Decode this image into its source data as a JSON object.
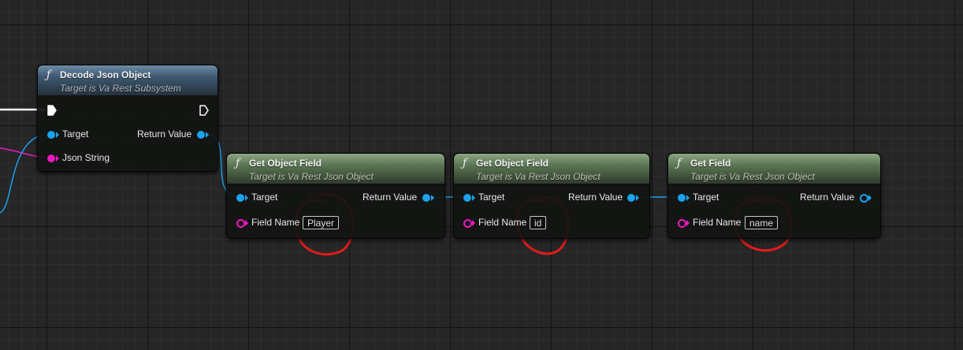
{
  "nodes": {
    "decode": {
      "title": "Decode Json Object",
      "subtitle": "Target is Va Rest Subsystem",
      "pin_target": "Target",
      "pin_json_string": "Json String",
      "pin_return": "Return Value"
    },
    "get_object_field_1": {
      "title": "Get Object Field",
      "subtitle": "Target is Va Rest Json Object",
      "pin_target": "Target",
      "pin_field_name": "Field Name",
      "field_value": "Player",
      "pin_return": "Return Value"
    },
    "get_object_field_2": {
      "title": "Get Object Field",
      "subtitle": "Target is Va Rest Json Object",
      "pin_target": "Target",
      "pin_field_name": "Field Name",
      "field_value": "id",
      "pin_return": "Return Value"
    },
    "get_field": {
      "title": "Get Field",
      "subtitle": "Target is Va Rest Json Object",
      "pin_target": "Target",
      "pin_field_name": "Field Name",
      "field_value": "name",
      "pin_return": "Return Value"
    }
  },
  "icons": {
    "function": "function-icon",
    "exec_in": "exec-in-pin-icon",
    "exec_out": "exec-out-pin-icon"
  },
  "colors": {
    "object_pin": "#1aa3ee",
    "string_pin": "#ea19c0",
    "exec_wire": "#ffffff",
    "annotation": "#e21b1b",
    "pure_header": "#5b7654",
    "callable_header": "#3e5870"
  }
}
